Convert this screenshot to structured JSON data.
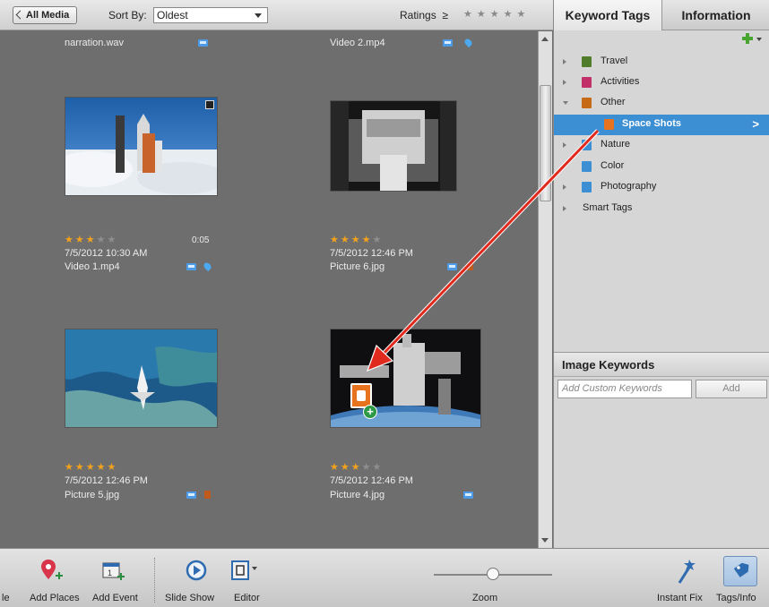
{
  "toolbar": {
    "back_label": "All Media",
    "sort_label": "Sort By:",
    "sort_value": "Oldest",
    "ratings_label": "Ratings",
    "ratings_op": "≥",
    "ratings_stars": "★★★★★"
  },
  "grid": {
    "top_left_name": "narration.wav",
    "top_right_name": "Video 2.mp4",
    "items": [
      {
        "name": "Video 1.mp4",
        "date": "7/5/2012 10:30 AM",
        "rating": 3,
        "duration": "0:05"
      },
      {
        "name": "Picture 6.jpg",
        "date": "7/5/2012 12:46 PM",
        "rating": 4,
        "duration": ""
      },
      {
        "name": "Picture 5.jpg",
        "date": "7/5/2012 12:46 PM",
        "rating": 5,
        "duration": ""
      },
      {
        "name": "Picture 4.jpg",
        "date": "7/5/2012 12:46 PM",
        "rating": 3,
        "duration": ""
      }
    ],
    "star_on": "★",
    "star_off": "★"
  },
  "panel": {
    "tabs": [
      {
        "label": "Keyword Tags"
      },
      {
        "label": "Information"
      }
    ],
    "tree": [
      {
        "label": "Travel",
        "color": "#4f7d2c"
      },
      {
        "label": "Activities",
        "color": "#c2306a"
      },
      {
        "label": "Other",
        "color": "#c76a17"
      },
      {
        "label": "Space Shots",
        "color": "#e8731e"
      },
      {
        "label": "Nature",
        "color": "#3d8fd4"
      },
      {
        "label": "Color",
        "color": "#3d8fd4"
      },
      {
        "label": "Photography",
        "color": "#3d8fd4"
      },
      {
        "label": "Smart Tags",
        "color": ""
      }
    ],
    "selected_chevron": ">",
    "image_keywords": {
      "header": "Image Keywords",
      "placeholder": "Add Custom Keywords",
      "add_label": "Add"
    }
  },
  "bottombar": {
    "cut_label": "le",
    "items": [
      {
        "label": "Add Places"
      },
      {
        "label": "Add Event"
      },
      {
        "label": "Slide Show"
      },
      {
        "label": "Editor"
      },
      {
        "label": "Zoom"
      },
      {
        "label": "Instant Fix"
      },
      {
        "label": "Tags/Info"
      }
    ],
    "event_icon_text": "1",
    "zoom_level": 0.5
  },
  "colors": {
    "accent": "#3d8fd4",
    "star": "#f2a21c",
    "drag_arrow": "#e02a1e"
  }
}
